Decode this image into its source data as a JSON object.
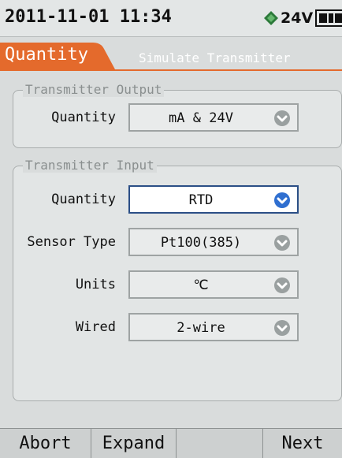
{
  "status": {
    "datetime": "2011-11-01 11:34",
    "voltage": "24V",
    "icons": {
      "plug": "plug-icon",
      "battery": "battery-icon"
    }
  },
  "tabs": {
    "active": "Quantity",
    "inactive": "Simulate Transmitter"
  },
  "output_panel": {
    "title": "Transmitter Output",
    "fields": [
      {
        "label": "Quantity",
        "value": "mA & 24V"
      }
    ]
  },
  "input_panel": {
    "title": "Transmitter Input",
    "fields": [
      {
        "label": "Quantity",
        "value": "RTD",
        "focused": true
      },
      {
        "label": "Sensor Type",
        "value": "Pt100(385)"
      },
      {
        "label": "Units",
        "value": "℃"
      },
      {
        "label": "Wired",
        "value": "2-wire"
      }
    ]
  },
  "softkeys": [
    "Abort",
    "Expand",
    "",
    "Next"
  ],
  "colors": {
    "accent": "#e46a2c",
    "focus": "#2b4f86",
    "chevron_active": "#2f6fd0",
    "chevron_inactive": "#9aa0a0"
  }
}
